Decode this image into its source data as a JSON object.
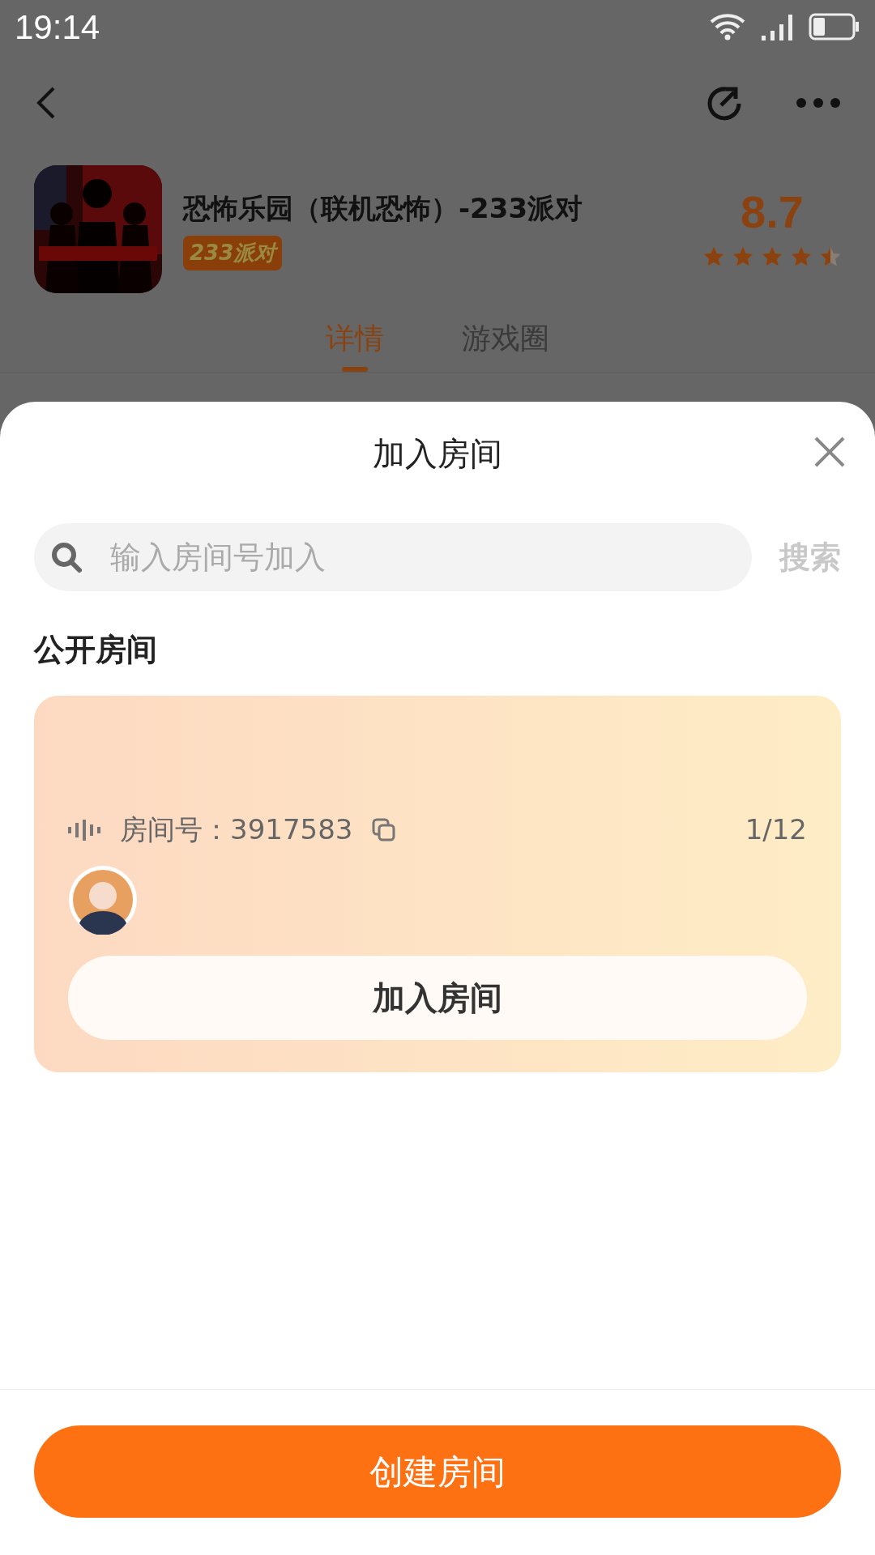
{
  "status_bar": {
    "time": "19:14"
  },
  "game": {
    "title": "恐怖乐园（联机恐怖）-233派对",
    "badge": "233派对",
    "rating": "8.7",
    "stars": 4.5
  },
  "tabs": [
    {
      "label": "详情",
      "selected": true
    },
    {
      "label": "游戏圈",
      "selected": false
    }
  ],
  "sheet": {
    "title": "加入房间",
    "search": {
      "placeholder": "输入房间号加入",
      "button": "搜索"
    },
    "section_title": "公开房间",
    "rooms": [
      {
        "room_label": "房间号：3917583",
        "count": "1/12",
        "join": "加入房间"
      }
    ],
    "create_button": "创建房间"
  }
}
